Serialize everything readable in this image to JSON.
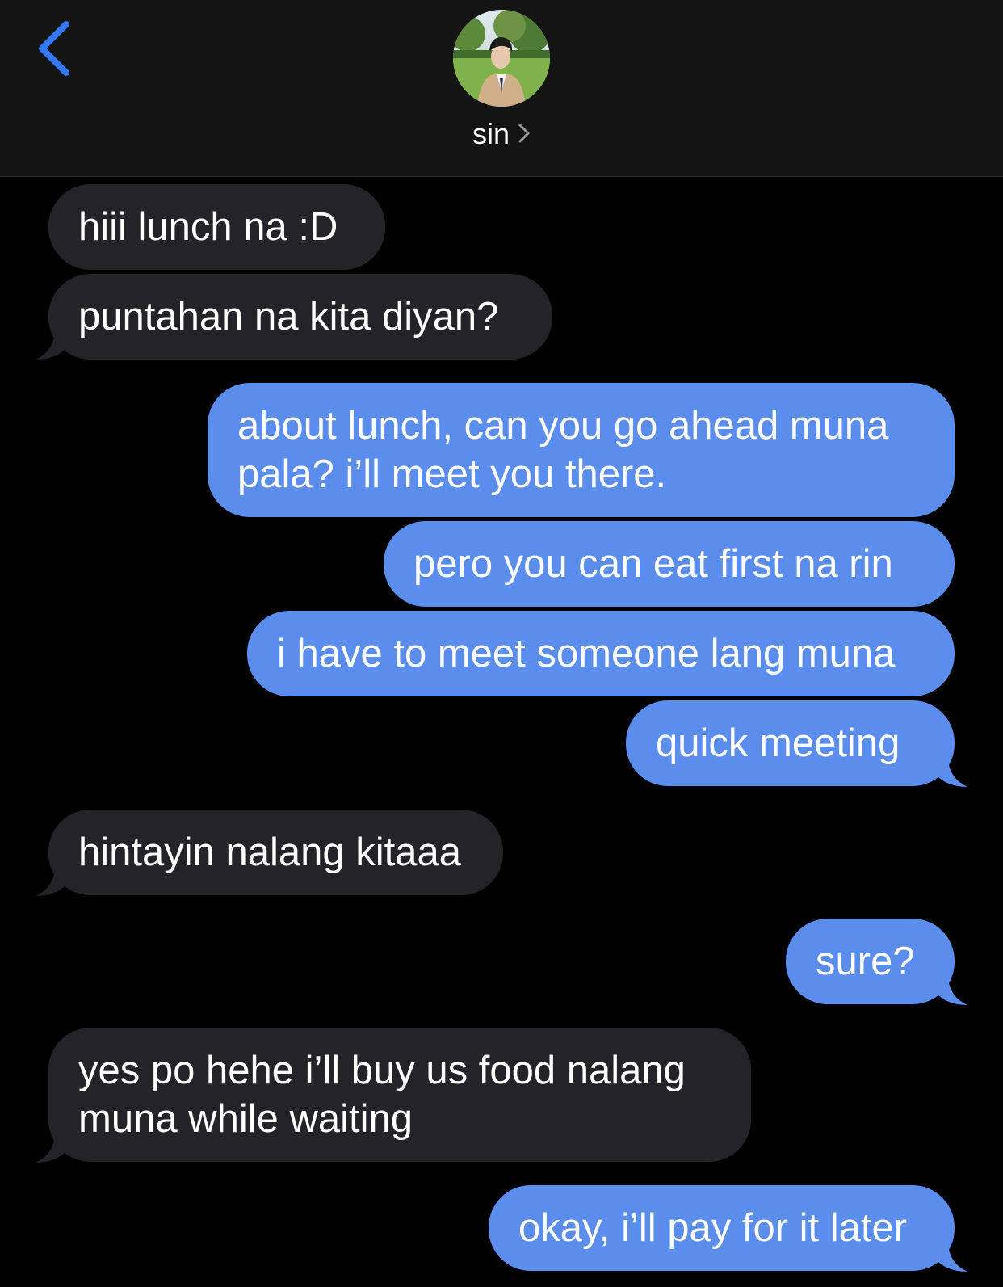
{
  "header": {
    "contact_name": "sin",
    "back_icon": "chevron-left-icon",
    "name_chevron_icon": "chevron-right-icon",
    "accent_color": "#3478F6"
  },
  "conversation": {
    "incoming_color": "#242428",
    "outgoing_color": "#5B8DED",
    "messages": [
      {
        "direction": "incoming",
        "text": "hiii lunch na :D"
      },
      {
        "direction": "incoming",
        "text": "puntahan na kita diyan?"
      },
      {
        "direction": "outgoing",
        "lines": [
          "about lunch, can you go ahead muna",
          "pala? i’ll meet you there."
        ]
      },
      {
        "direction": "outgoing",
        "text": "pero you can eat first na rin"
      },
      {
        "direction": "outgoing",
        "text": "i have to meet someone lang muna"
      },
      {
        "direction": "outgoing",
        "text": "quick meeting"
      },
      {
        "direction": "incoming",
        "text": "hintayin nalang kitaaa"
      },
      {
        "direction": "outgoing",
        "text": "sure?"
      },
      {
        "direction": "incoming",
        "lines": [
          "yes po hehe i’ll buy us food nalang",
          "muna while waiting"
        ]
      },
      {
        "direction": "outgoing",
        "text": "okay, i’ll pay for it later"
      }
    ]
  }
}
